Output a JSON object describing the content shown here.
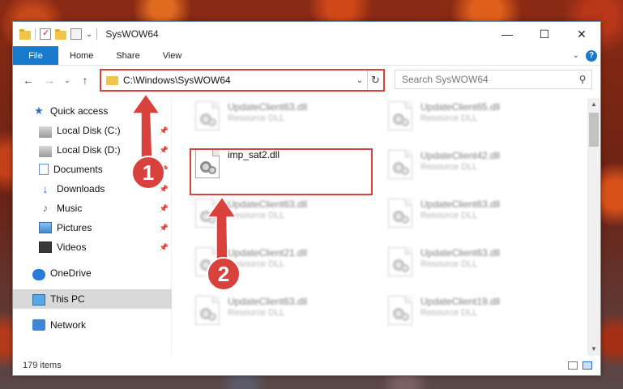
{
  "window": {
    "title": "SysWOW64",
    "min_glyph": "—",
    "max_glyph": "☐",
    "close_glyph": "✕"
  },
  "ribbon": {
    "file": "File",
    "tabs": [
      "Home",
      "Share",
      "View"
    ],
    "expand_glyph": "⌄",
    "help_glyph": "?"
  },
  "nav": {
    "back_glyph": "←",
    "forward_glyph": "→",
    "recent_glyph": "⌄",
    "up_glyph": "↑"
  },
  "address": {
    "path": "C:\\Windows\\SysWOW64",
    "dropdown_glyph": "⌄",
    "refresh_glyph": "↻"
  },
  "search": {
    "placeholder": "Search SysWOW64",
    "icon_glyph": "⚲"
  },
  "sidebar": {
    "items": [
      {
        "label": "Quick access",
        "icon": "star-icon",
        "pinned": false
      },
      {
        "label": "Local Disk (C:)",
        "icon": "disk-icon",
        "pinned": true
      },
      {
        "label": "Local Disk (D:)",
        "icon": "disk-icon",
        "pinned": true
      },
      {
        "label": "Documents",
        "icon": "document-icon",
        "pinned": true
      },
      {
        "label": "Downloads",
        "icon": "download-icon",
        "pinned": true
      },
      {
        "label": "Music",
        "icon": "music-icon",
        "pinned": true
      },
      {
        "label": "Pictures",
        "icon": "picture-icon",
        "pinned": true
      },
      {
        "label": "Videos",
        "icon": "video-icon",
        "pinned": true
      },
      {
        "label": "OneDrive",
        "icon": "cloud-icon",
        "pinned": false
      },
      {
        "label": "This PC",
        "icon": "computer-icon",
        "pinned": false,
        "selected": true
      },
      {
        "label": "Network",
        "icon": "network-icon",
        "pinned": false
      }
    ],
    "pin_glyph": "📌",
    "star_glyph": "★",
    "download_glyph": "↓",
    "music_glyph": "♪"
  },
  "files": {
    "col1": [
      {
        "name": "UpdateClient63.dll",
        "type": "Resource DLL"
      },
      {
        "name": "imp_sat2.dll",
        "type": ""
      },
      {
        "name": "UpdateClient63.dll",
        "type": "Resource DLL"
      },
      {
        "name": "UpdateClient21.dll",
        "type": "Resource DLL"
      },
      {
        "name": "UpdateClient63.dll",
        "type": "Resource DLL"
      }
    ],
    "col2": [
      {
        "name": "UpdateClient65.dll",
        "type": "Resource DLL"
      },
      {
        "name": "UpdateClient42.dll",
        "type": "Resource DLL"
      },
      {
        "name": "UpdateClient63.dll",
        "type": "Resource DLL"
      },
      {
        "name": "UpdateClient63.dll",
        "type": "Resource DLL"
      },
      {
        "name": "UpdateClient19.dll",
        "type": "Resource DLL"
      }
    ]
  },
  "status": {
    "item_count": "179 items"
  },
  "annotations": {
    "step1": "1",
    "step2": "2",
    "color": "#d9413c"
  }
}
